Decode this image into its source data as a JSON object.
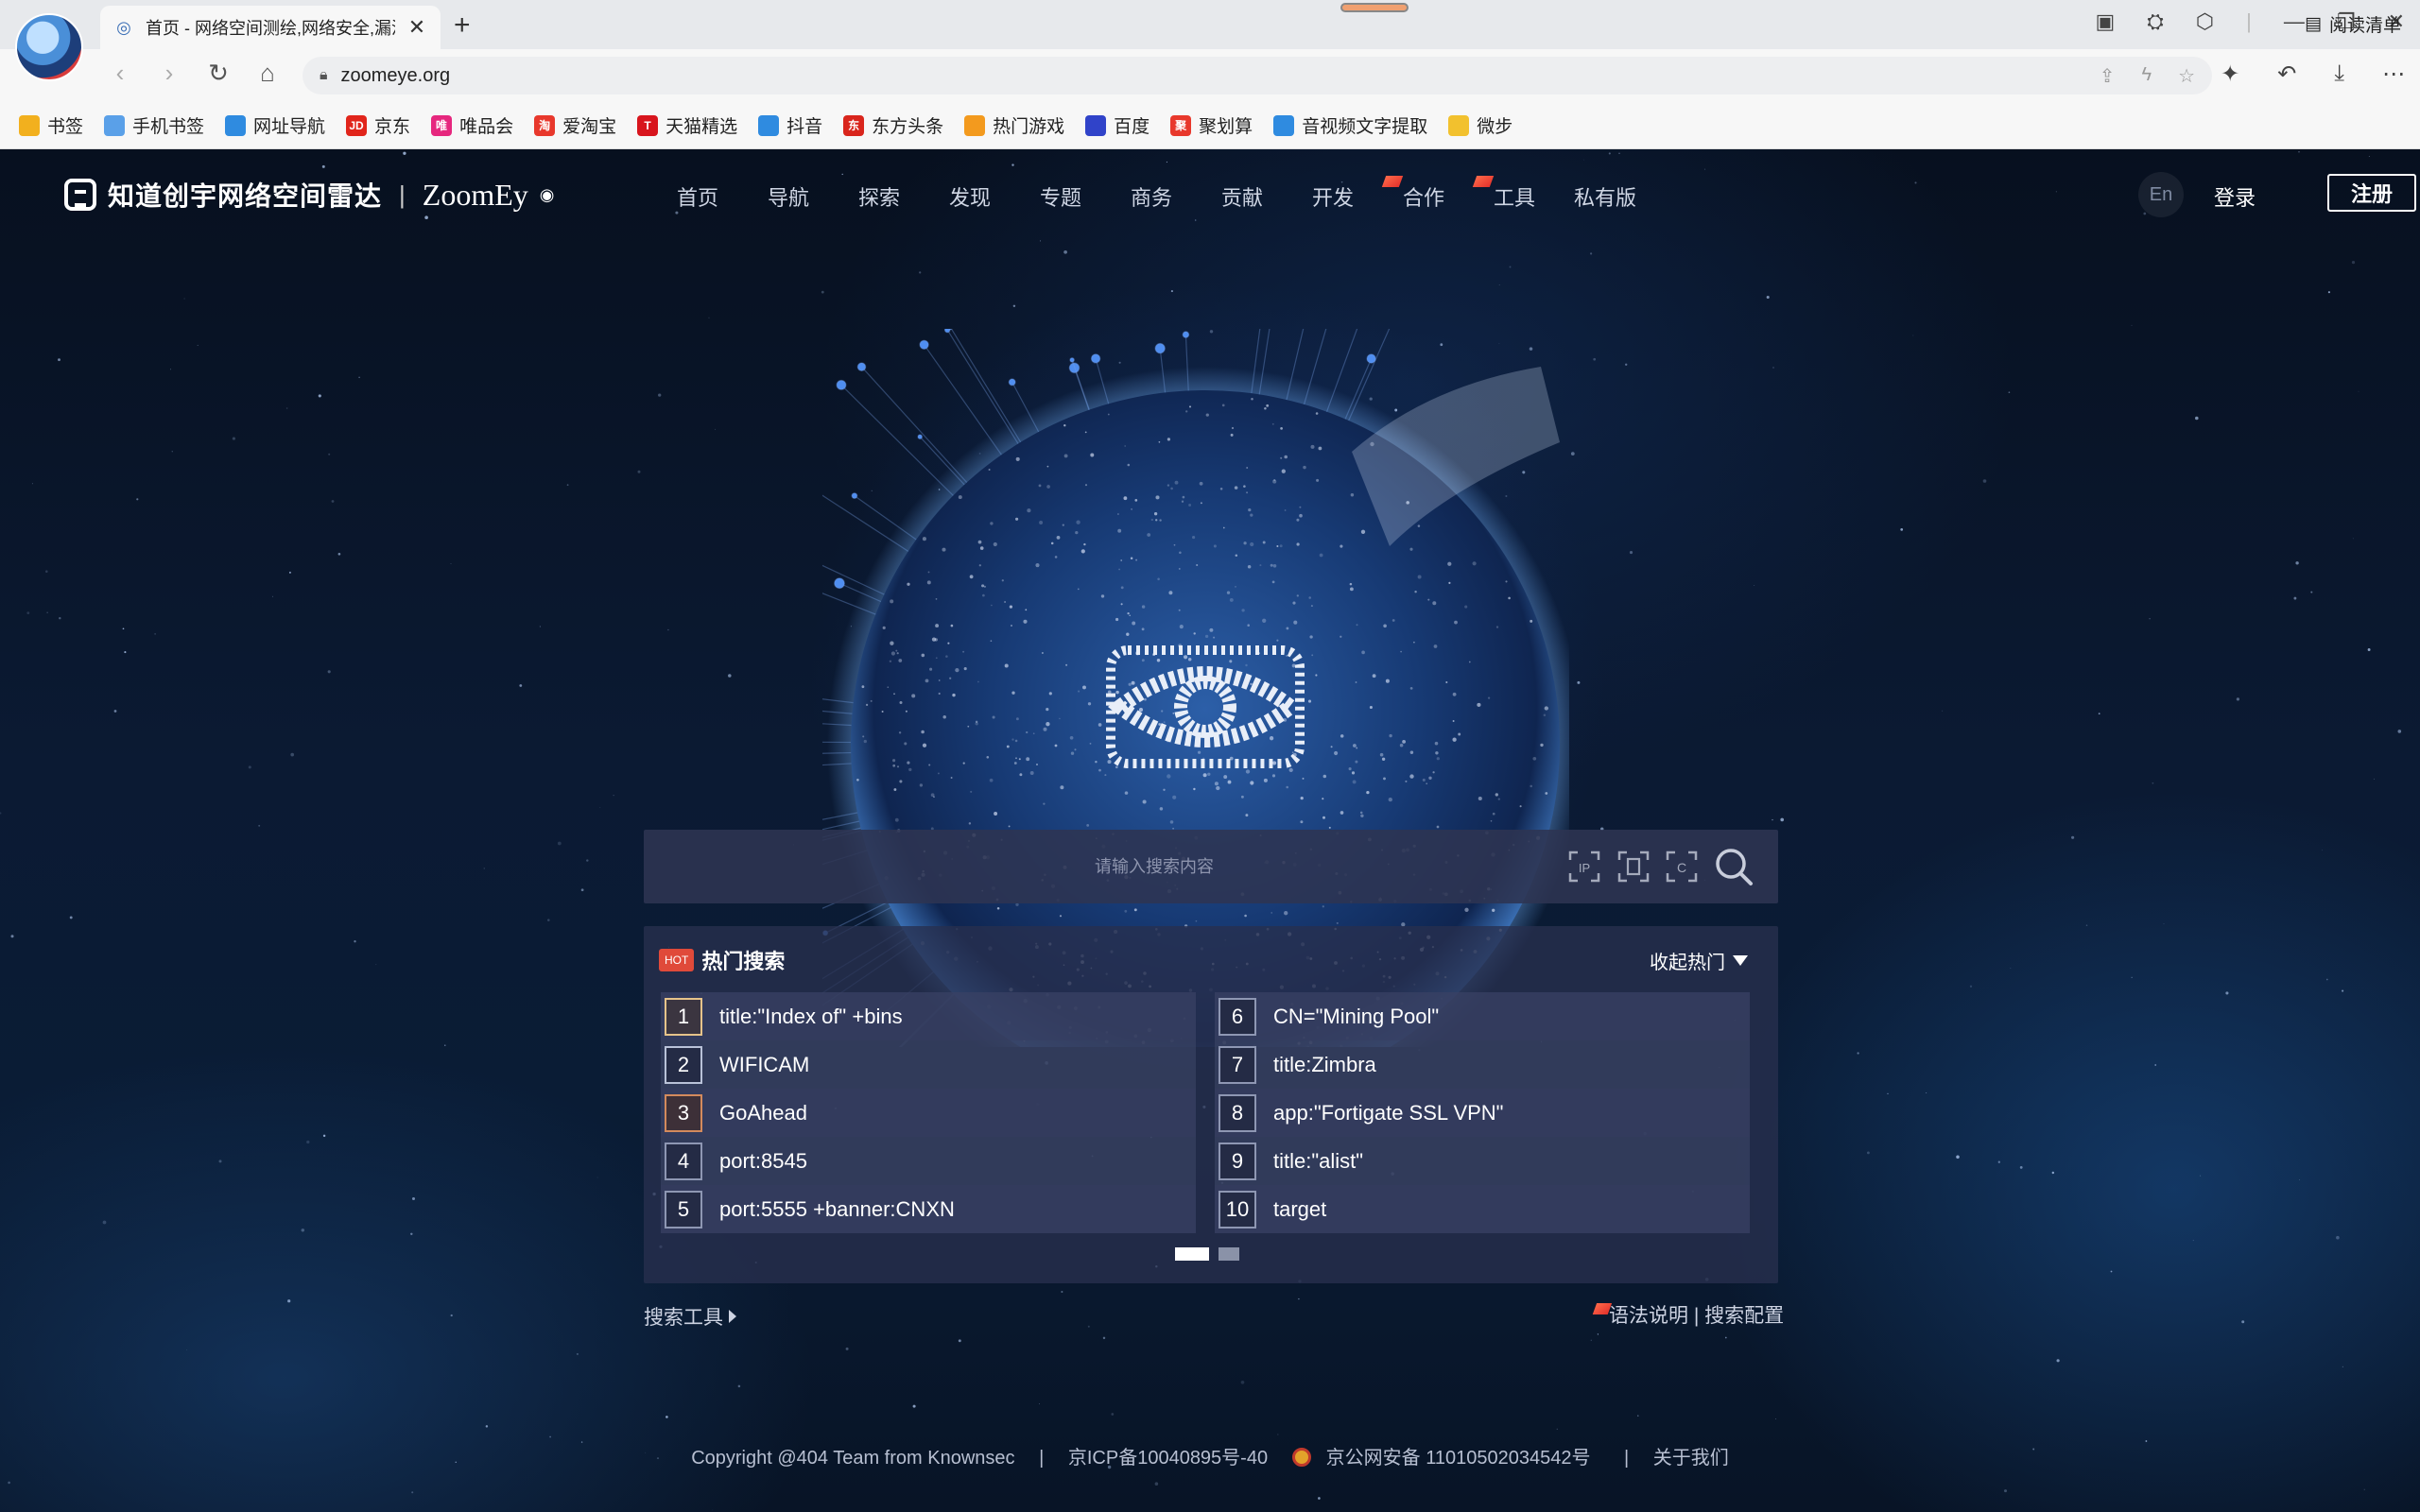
{
  "browser": {
    "tab_title": "首页 - 网络空间测绘,网络安全,漏洞",
    "tab_close": "✕",
    "new_tab": "+",
    "url": "zoomeye.org",
    "bookmarks": [
      {
        "label": "书签",
        "icon": "star-icon",
        "color": "#f2b01e"
      },
      {
        "label": "手机书签",
        "icon": "phone-icon",
        "color": "#5aa0e8"
      },
      {
        "label": "网址导航",
        "icon": "e-icon",
        "color": "#2f8be0"
      },
      {
        "label": "京东",
        "icon": "jd-icon",
        "color": "#e1251b",
        "text": "JD"
      },
      {
        "label": "唯品会",
        "icon": "vip-icon",
        "color": "#e6277e",
        "text": "唯"
      },
      {
        "label": "爱淘宝",
        "icon": "taobao-icon",
        "color": "#e8382c",
        "text": "淘"
      },
      {
        "label": "天猫精选",
        "icon": "tmall-icon",
        "color": "#d8151d",
        "text": "T"
      },
      {
        "label": "抖音",
        "icon": "e-icon",
        "color": "#2f8be0"
      },
      {
        "label": "东方头条",
        "icon": "dongfang-icon",
        "color": "#d9251c",
        "text": "东"
      },
      {
        "label": "热门游戏",
        "icon": "game-icon",
        "color": "#f39a1e"
      },
      {
        "label": "百度",
        "icon": "baidu-paw-icon",
        "color": "#3043c9"
      },
      {
        "label": "聚划算",
        "icon": "juhuasuan-icon",
        "color": "#e8382c",
        "text": "聚"
      },
      {
        "label": "音视频文字提取",
        "icon": "e-icon",
        "color": "#2f8be0"
      },
      {
        "label": "微步",
        "icon": "folder-icon",
        "color": "#f2c12e"
      }
    ],
    "reading_list": "阅读清单"
  },
  "site": {
    "logo_cn": "知道创宇网络空间雷达",
    "logo_sep": "|",
    "logo_en": "ZoomEy",
    "nav": [
      {
        "label": "首页",
        "flag": false
      },
      {
        "label": "导航",
        "flag": false
      },
      {
        "label": "探索",
        "flag": false
      },
      {
        "label": "发现",
        "flag": false
      },
      {
        "label": "专题",
        "flag": false
      },
      {
        "label": "商务",
        "flag": false
      },
      {
        "label": "贡献",
        "flag": false
      },
      {
        "label": "开发",
        "flag": false
      },
      {
        "label": "合作",
        "flag": true
      },
      {
        "label": "工具",
        "flag": true
      },
      {
        "label": "私有版",
        "flag": false
      }
    ],
    "lang": "En",
    "login": "登录",
    "register": "注册"
  },
  "search": {
    "placeholder": "请输入搜索内容"
  },
  "hot": {
    "badge": "HOT",
    "title": "热门搜索",
    "collapse": "收起热门",
    "left": [
      {
        "rank": "1",
        "text": "title:\"Index of\" +bins",
        "style": "gold"
      },
      {
        "rank": "2",
        "text": "WIFICAM",
        "style": "silver"
      },
      {
        "rank": "3",
        "text": "GoAhead",
        "style": "bronze"
      },
      {
        "rank": "4",
        "text": "port:8545",
        "style": ""
      },
      {
        "rank": "5",
        "text": "port:5555 +banner:CNXN",
        "style": ""
      }
    ],
    "right": [
      {
        "rank": "6",
        "text": "CN=\"Mining Pool\"",
        "style": ""
      },
      {
        "rank": "7",
        "text": "title:Zimbra",
        "style": ""
      },
      {
        "rank": "8",
        "text": "app:\"Fortigate SSL VPN\"",
        "style": ""
      },
      {
        "rank": "9",
        "text": "title:\"alist\"",
        "style": ""
      },
      {
        "rank": "10",
        "text": "target",
        "style": ""
      }
    ]
  },
  "links": {
    "tools": "搜索工具",
    "syntax": "语法说明 | 搜索配置"
  },
  "footer": {
    "copyright": "Copyright @404 Team from Knownsec",
    "sep": "|",
    "icp": "京ICP备10040895号-40",
    "police": "京公网安备 11010502034542号",
    "about": "关于我们"
  }
}
